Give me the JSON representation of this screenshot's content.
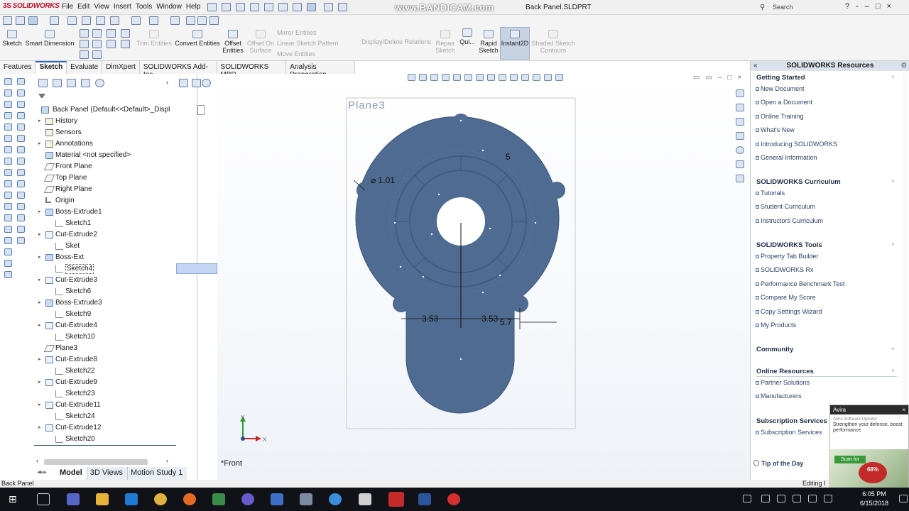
{
  "app": {
    "logo": "SOLIDWORKS",
    "menus": [
      "File",
      "Edit",
      "View",
      "Insert",
      "Tools",
      "Window",
      "Help"
    ],
    "watermark": "www.BANDICAM.com",
    "document_title": "Back Panel.SLDPRT",
    "search_placeholder": "Search SOLIDWORKS Help",
    "window_controls": [
      "?",
      "-",
      "–",
      "□",
      "×"
    ]
  },
  "ribbon": {
    "items": [
      {
        "label": "Sketch",
        "state": "normal"
      },
      {
        "label": "Smart Dimension",
        "state": "normal"
      },
      {
        "label": "Trim Entities",
        "state": "dim"
      },
      {
        "label": "Convert Entities",
        "state": "normal"
      },
      {
        "label": "Offset Entities",
        "state": "normal"
      },
      {
        "label": "Offset On Surface",
        "state": "dim"
      },
      {
        "label": "Mirror Entities",
        "state": "dim"
      },
      {
        "label": "Linear Sketch Pattern",
        "state": "dim"
      },
      {
        "label": "Move Entities",
        "state": "dim"
      },
      {
        "label": "Display/Delete Relations",
        "state": "dim"
      },
      {
        "label": "Repair Sketch",
        "state": "dim"
      },
      {
        "label": "Qui...",
        "state": "normal"
      },
      {
        "label": "Rapid Sketch",
        "state": "normal"
      },
      {
        "label": "Instant2D",
        "state": "active"
      },
      {
        "label": "Shaded Sketch Contours",
        "state": "dim"
      }
    ]
  },
  "tabs": [
    "Features",
    "Sketch",
    "Evaluate",
    "DimXpert",
    "SOLIDWORKS Add-Ins",
    "SOLIDWORKS MBD",
    "Analysis Preparation"
  ],
  "active_tab": "Sketch",
  "tree": {
    "root": "Back Panel  (Default<<Default>_Displ",
    "items": [
      {
        "label": "History",
        "icon": "folder-icon",
        "expander": true
      },
      {
        "label": "Sensors",
        "icon": "folder-icon",
        "expander": false
      },
      {
        "label": "Annotations",
        "icon": "folder-icon",
        "expander": true
      },
      {
        "label": "Material <not specified>",
        "icon": "material-icon",
        "expander": false
      },
      {
        "label": "Front Plane",
        "icon": "plane-icon",
        "expander": false
      },
      {
        "label": "Top Plane",
        "icon": "plane-icon",
        "expander": false
      },
      {
        "label": "Right Plane",
        "icon": "plane-icon",
        "expander": false
      },
      {
        "label": "Origin",
        "icon": "origin-icon",
        "expander": false
      },
      {
        "label": "Boss-Extrude1",
        "icon": "feature-icon",
        "expander": true
      },
      {
        "label": "Sketch1",
        "icon": "sketch-icon",
        "expander": false,
        "child": true
      },
      {
        "label": "Cut-Extrude2",
        "icon": "cut-icon",
        "expander": true
      },
      {
        "label": "Sket",
        "icon": "sketch-icon",
        "expander": false,
        "child": true
      },
      {
        "label": "Boss-Ext",
        "icon": "feature-icon",
        "expander": true
      },
      {
        "label": "Sketch4",
        "icon": "sketch-icon",
        "expander": false,
        "child": true,
        "selected": true
      },
      {
        "label": "Cut-Extrude3",
        "icon": "cut-icon",
        "expander": true
      },
      {
        "label": "Sketch6",
        "icon": "sketch-icon",
        "expander": false,
        "child": true
      },
      {
        "label": "Boss-Extrude3",
        "icon": "feature-icon",
        "expander": true
      },
      {
        "label": "Sketch9",
        "icon": "sketch-icon",
        "expander": false,
        "child": true
      },
      {
        "label": "Cut-Extrude4",
        "icon": "cut-icon",
        "expander": true
      },
      {
        "label": "Sketch10",
        "icon": "sketch-icon",
        "expander": false,
        "child": true
      },
      {
        "label": "Plane3",
        "icon": "plane-icon",
        "expander": false
      },
      {
        "label": "Cut-Extrude8",
        "icon": "cut-icon",
        "expander": true
      },
      {
        "label": "Sketch22",
        "icon": "sketch-icon",
        "expander": false,
        "child": true
      },
      {
        "label": "Cut-Extrude9",
        "icon": "cut-icon",
        "expander": true
      },
      {
        "label": "Sketch23",
        "icon": "sketch-icon",
        "expander": false,
        "child": true
      },
      {
        "label": "Cut-Extrude11",
        "icon": "cut-icon",
        "expander": true
      },
      {
        "label": "Sketch24",
        "icon": "sketch-icon",
        "expander": false,
        "child": true
      },
      {
        "label": "Cut-Extrude12",
        "icon": "cut-icon",
        "expander": true
      },
      {
        "label": "Sketch20",
        "icon": "sketch-icon",
        "expander": false,
        "child": true
      }
    ]
  },
  "bottom_tabs": [
    "Model",
    "3D Views",
    "Motion Study 1"
  ],
  "status": {
    "left": "Back Panel",
    "right": "Editing I"
  },
  "viewport": {
    "plane_label": "Plane3",
    "view_name": "*Front",
    "dimensions": {
      "diameter": "⌀ 1.01",
      "top": "5",
      "left_width": "3.53",
      "right_width": "3.53",
      "offset": "5.7"
    },
    "triad": {
      "x": "X",
      "y": "Y"
    }
  },
  "task_pane": {
    "title": "SOLIDWORKS Resources",
    "sections": [
      {
        "title": "Getting Started",
        "items": [
          "New Document",
          "Open a Document",
          "Online Training",
          "What's New",
          "Introducing SOLIDWORKS",
          "General Information"
        ]
      },
      {
        "title": "SOLIDWORKS Curriculum",
        "items": [
          "Tutorials",
          "Student Curriculum",
          "Instructors Curriculum"
        ]
      },
      {
        "title": "SOLIDWORKS Tools",
        "items": [
          "Property Tab Builder",
          "SOLIDWORKS Rx",
          "Performance Benchmark Test",
          "Compare My Score",
          "Copy Settings Wizard",
          "My Products"
        ]
      },
      {
        "title": "Community",
        "items": []
      },
      {
        "title": "Online Resources",
        "items": [
          "Partner Solutions",
          "Manufacturers"
        ]
      },
      {
        "title": "Subscription Services",
        "items": [
          "Subscription Services"
        ]
      }
    ],
    "tip": "Tip of the Day"
  },
  "popup": {
    "app": "Avira",
    "headline": "Avira Software Updater",
    "text": "Strengthen your defense, boost performance",
    "button": "Scan for",
    "badge": "68%"
  },
  "taskbar": {
    "time": "6:05 PM",
    "date": "6/15/2018"
  },
  "colors": {
    "part": "#4f6b91",
    "accent": "#2f68c0",
    "taskbar": "#101218"
  }
}
